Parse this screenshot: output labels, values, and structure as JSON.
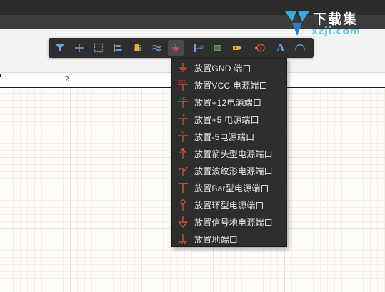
{
  "ruler": {
    "label": "2"
  },
  "watermark": {
    "title": "下载集",
    "url": "xzji.com"
  },
  "toolbar": {
    "items": [
      {
        "icon": "filter-icon"
      },
      {
        "icon": "crosshair-icon"
      },
      {
        "icon": "select-rect-icon"
      },
      {
        "icon": "align-icon"
      },
      {
        "icon": "component-icon"
      },
      {
        "icon": "wire-icon"
      },
      {
        "icon": "power-port-icon",
        "active": true
      },
      {
        "icon": "bus-icon"
      },
      {
        "icon": "net-label-icon"
      },
      {
        "icon": "port-icon"
      },
      {
        "icon": "directive-icon"
      },
      {
        "icon": "text-icon",
        "glyph": "A"
      },
      {
        "icon": "arc-icon"
      }
    ]
  },
  "power_menu": {
    "items": [
      {
        "label": "放置GND 端口",
        "icon": "gnd-power-icon"
      },
      {
        "label": "放置VCC 电源端口",
        "icon": "vcc-power-icon",
        "icon_text": "VCC"
      },
      {
        "label": "放置+12电源端口",
        "icon": "plus12-power-icon",
        "icon_text": "+12"
      },
      {
        "label": "放置+5 电源端口",
        "icon": "plus5-power-icon",
        "icon_text": "+5"
      },
      {
        "label": "放置-5电源端口",
        "icon": "minus5-power-icon",
        "icon_text": "-5"
      },
      {
        "label": "放置箭头型电源端口",
        "icon": "arrow-power-icon"
      },
      {
        "label": "放置波纹形电源端口",
        "icon": "wave-power-icon"
      },
      {
        "label": "放置Bar型电源端口",
        "icon": "bar-power-icon"
      },
      {
        "label": "放置环型电源端口",
        "icon": "circle-power-icon"
      },
      {
        "label": "放置信号地电源端口",
        "icon": "signal-ground-icon"
      },
      {
        "label": "放置地端口",
        "icon": "earth-ground-icon"
      }
    ]
  },
  "colors": {
    "toolbar_bg": "#2e2e2e",
    "menu_bg": "#2d2d2d",
    "menu_text": "#e8e8e8",
    "power_icon_red": "#e0553c",
    "toolbar_icon_blue": "#6aa0d8",
    "canvas_bg": "#fffdf8"
  }
}
